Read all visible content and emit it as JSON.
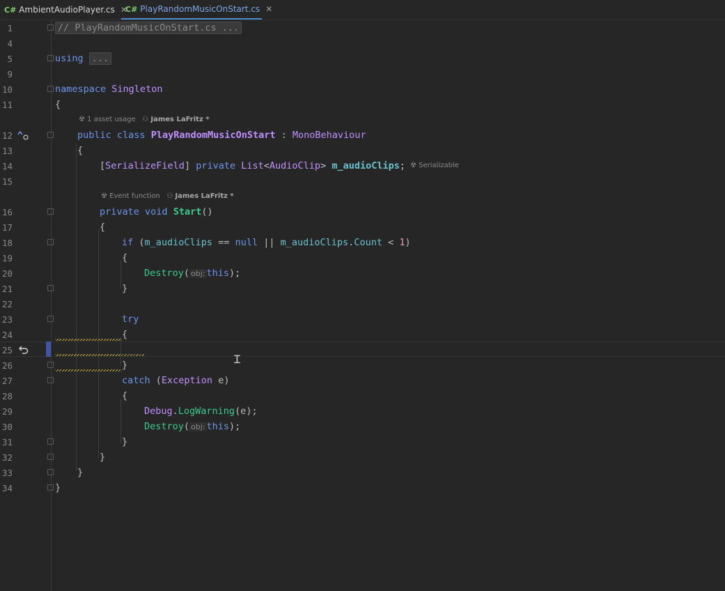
{
  "tabs": [
    {
      "lang": "C#",
      "label": "AmbientAudioPlayer.cs",
      "close": "✕"
    },
    {
      "lang": "C#",
      "label": "PlayRandomMusicOnStart.cs",
      "close": "✕"
    }
  ],
  "lines": {
    "n1": "1",
    "n4": "4",
    "n5": "5",
    "n9": "9",
    "n10": "10",
    "n11": "11",
    "n12": "12",
    "n13": "13",
    "n14": "14",
    "n15": "15",
    "n16": "16",
    "n17": "17",
    "n18": "18",
    "n19": "19",
    "n20": "20",
    "n21": "21",
    "n22": "22",
    "n23": "23",
    "n24": "24",
    "n25": "25",
    "n26": "26",
    "n27": "27",
    "n28": "28",
    "n29": "29",
    "n30": "30",
    "n31": "31",
    "n32": "32",
    "n33": "33",
    "n34": "34"
  },
  "code": {
    "comment": "// PlayRandomMusicOnStart.cs",
    "ellipsis": "...",
    "using": "using",
    "namespace_kw": "namespace",
    "namespace_name": "Singleton",
    "public": "public",
    "class_kw": "class",
    "class_name": "PlayRandomMusicOnStart",
    "colon": " : ",
    "base_class": "MonoBehaviour",
    "attr": "SerializeField",
    "private": "private",
    "list": "List",
    "audio_clip": "AudioClip",
    "field": "m_audioClips",
    "void": "void",
    "start": "Start",
    "if_kw": "if",
    "null_kw": "null",
    "count": "Count",
    "one": "1",
    "destroy": "Destroy",
    "obj_hint": "obj:",
    "this_kw": "this",
    "try_kw": "try",
    "catch_kw": "catch",
    "exception": "Exception",
    "var_e": "e",
    "debug": "Debug",
    "log_warning": "LogWarning",
    "open_brace": "{",
    "close_brace": "}"
  },
  "hints": {
    "asset_usage": "1 asset usage",
    "author": "James LaFritz *",
    "serializable": "Serializable",
    "event_function": "Event function"
  }
}
